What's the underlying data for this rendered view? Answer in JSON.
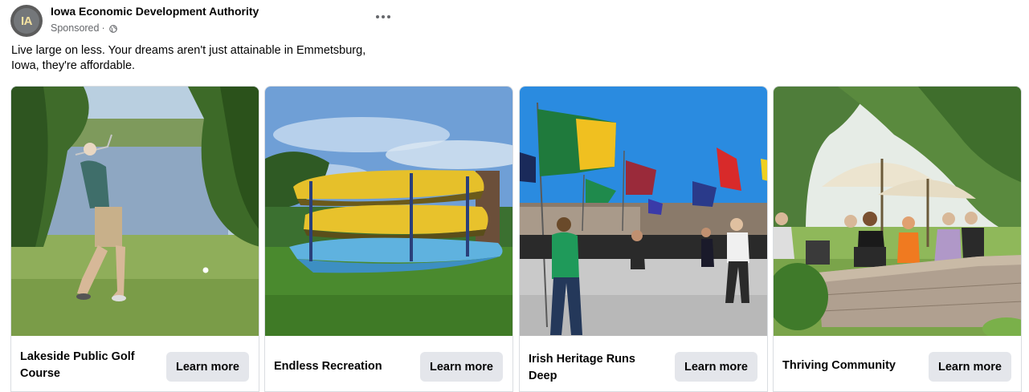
{
  "post": {
    "page_name": "Iowa Economic Development Authority",
    "avatar_initials": "IA",
    "sponsored_label": "Sponsored",
    "separator": "·",
    "privacy_icon": "globe-icon",
    "menu_icon": "more-options-icon",
    "text": "Live large on less. Your dreams aren't just attainable in Emmetsburg, Iowa, they're affordable."
  },
  "carousel": {
    "cards": [
      {
        "title": "Lakeside Public Golf Course",
        "button": "Learn more",
        "image": "golfer-by-lake-photo"
      },
      {
        "title": "Endless Recreation",
        "button": "Learn more",
        "image": "stacked-kayaks-photo"
      },
      {
        "title": "Irish Heritage Runs Deep",
        "button": "Learn more",
        "image": "flag-parade-photo"
      },
      {
        "title": "Thriving Community",
        "button": "Learn more",
        "image": "patio-gathering-photo"
      }
    ]
  },
  "colors": {
    "button_bg": "#e4e6eb",
    "meta_text": "#65676b",
    "card_border": "#dadde1"
  }
}
